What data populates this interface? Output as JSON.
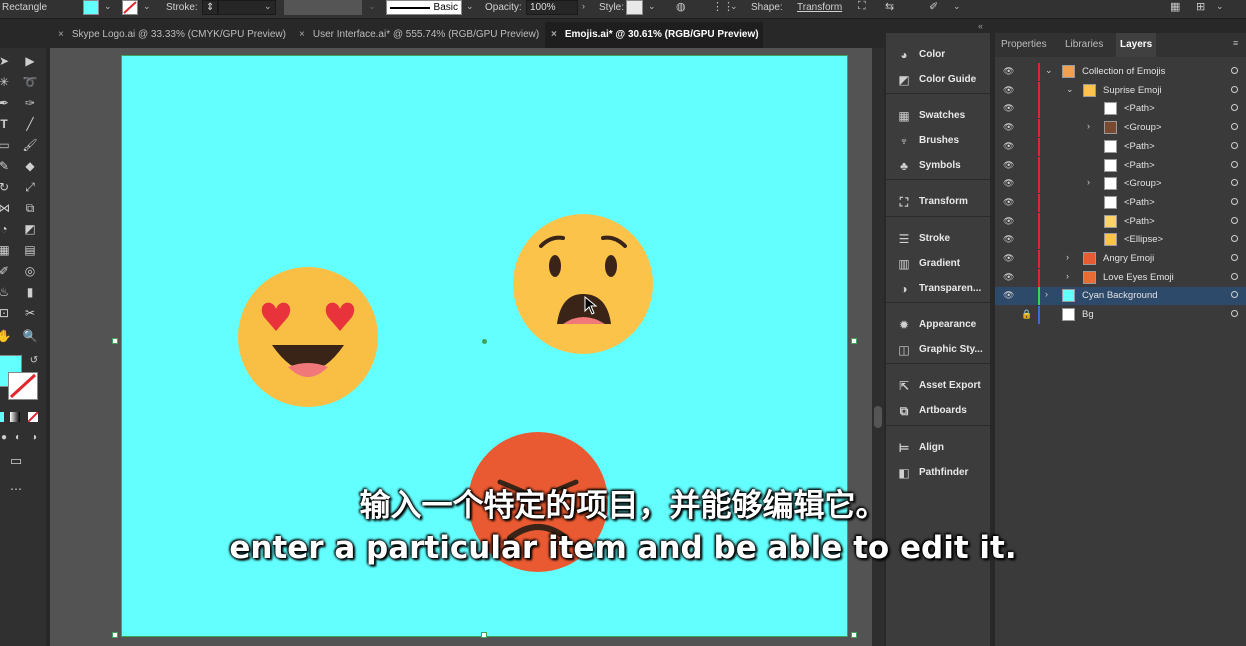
{
  "control_bar": {
    "tool_name": "Rectangle",
    "fill_color": "#63ffff",
    "stroke_label": "Stroke:",
    "brush_label": "Basic",
    "opacity_label": "Opacity:",
    "opacity_value": "100%",
    "style_label": "Style:",
    "shape_label": "Shape:",
    "transform_label": "Transform"
  },
  "tabs": [
    {
      "label": "Skype Logo.ai @ 33.33% (CMYK/GPU Preview)",
      "active": false
    },
    {
      "label": "User Interface.ai* @ 555.74% (RGB/GPU Preview)",
      "active": false
    },
    {
      "label": "Emojis.ai* @ 30.61% (RGB/GPU Preview)",
      "active": true
    }
  ],
  "dock": {
    "items": [
      {
        "label": "Color",
        "icon": "color-icon"
      },
      {
        "label": "Color Guide",
        "icon": "color-guide-icon"
      },
      {
        "label": "Swatches",
        "icon": "swatches-icon"
      },
      {
        "label": "Brushes",
        "icon": "brushes-icon"
      },
      {
        "label": "Symbols",
        "icon": "symbols-icon"
      },
      {
        "label": "Transform",
        "icon": "transform-icon"
      },
      {
        "label": "Stroke",
        "icon": "stroke-icon"
      },
      {
        "label": "Gradient",
        "icon": "gradient-icon"
      },
      {
        "label": "Transparen...",
        "icon": "transparency-icon"
      },
      {
        "label": "Appearance",
        "icon": "appearance-icon"
      },
      {
        "label": "Graphic Sty...",
        "icon": "graphic-styles-icon"
      },
      {
        "label": "Asset Export",
        "icon": "asset-export-icon"
      },
      {
        "label": "Artboards",
        "icon": "artboards-icon"
      },
      {
        "label": "Align",
        "icon": "align-icon"
      },
      {
        "label": "Pathfinder",
        "icon": "pathfinder-icon"
      }
    ]
  },
  "layers_panel": {
    "tabs": [
      "Properties",
      "Libraries",
      "Layers"
    ],
    "active_tab": "Layers",
    "rows": [
      {
        "name": "Collection of Emojis"
      },
      {
        "name": "Suprise Emoji"
      },
      {
        "name": "<Path>"
      },
      {
        "name": "<Group>"
      },
      {
        "name": "<Path>"
      },
      {
        "name": "<Path>"
      },
      {
        "name": "<Group>"
      },
      {
        "name": "<Path>"
      },
      {
        "name": "<Path>"
      },
      {
        "name": "<Ellipse>"
      },
      {
        "name": "Angry Emoji"
      },
      {
        "name": "Love Eyes Emoji"
      },
      {
        "name": "Cyan Background"
      },
      {
        "name": "Bg"
      }
    ]
  },
  "subtitles": {
    "cn": "输入一个特定的项目，并能够编辑它。",
    "en": "enter a particular item and be able to edit it."
  },
  "colors": {
    "artboard": "#63ffff",
    "emoji_yellow": "#fbc34a",
    "emoji_red": "#ea5a32",
    "selection": "#3fa25a"
  }
}
